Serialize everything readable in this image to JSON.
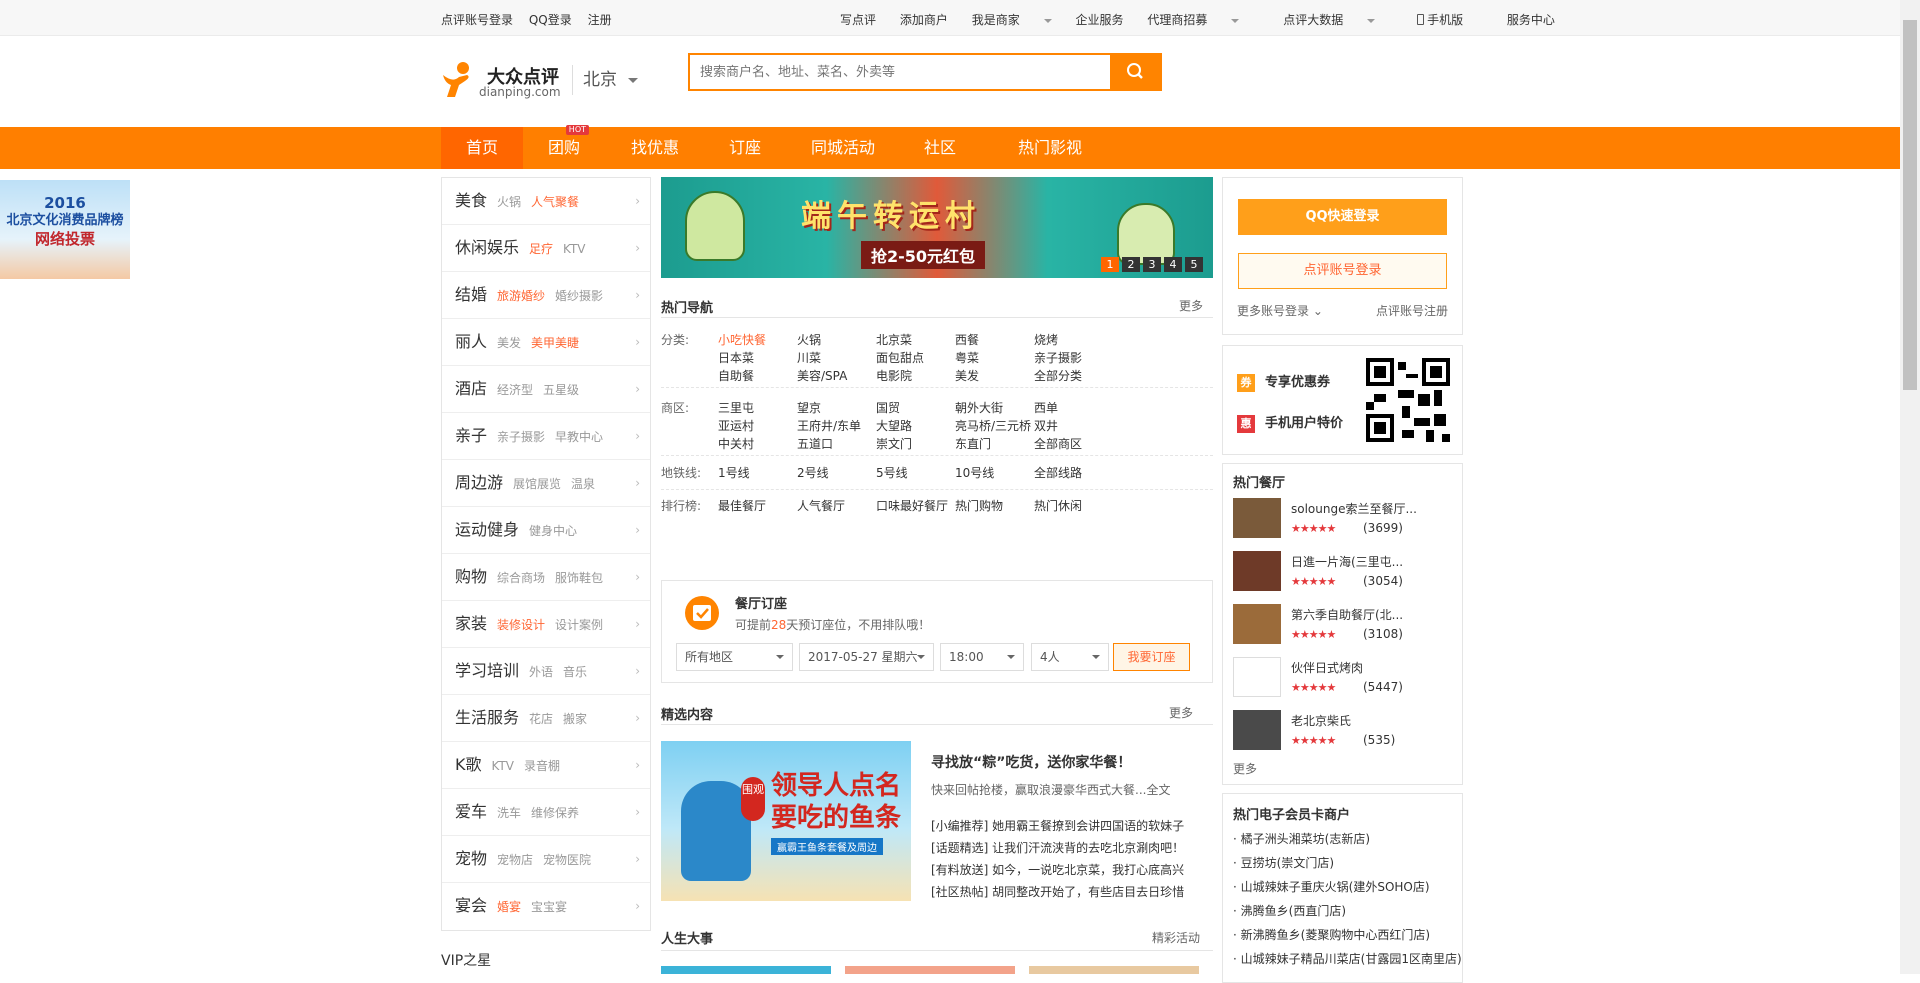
{
  "topbar": {
    "left": [
      "点评账号登录",
      "QQ登录",
      "注册"
    ],
    "right": [
      "写点评",
      "添加商户",
      "我是商家",
      "企业服务",
      "代理商招募",
      "点评大数据",
      "手机版",
      "服务中心"
    ]
  },
  "header": {
    "logo_cn": "大众点评",
    "logo_en": "dianping.com",
    "city": "北京",
    "search_placeholder": "搜索商户名、地址、菜名、外卖等"
  },
  "nav": {
    "items": [
      "首页",
      "团购",
      "找优惠",
      "订座",
      "同城活动",
      "社区",
      "热门影视"
    ],
    "hot_badge": "HOT"
  },
  "left_banner": {
    "line1": "2016",
    "line2": "北京文化消费品牌榜",
    "line3": "网络投票"
  },
  "categories": [
    {
      "name": "美食",
      "subs": [
        "火锅",
        "人气聚餐"
      ],
      "hl": [
        false,
        true
      ]
    },
    {
      "name": "休闲娱乐",
      "subs": [
        "足疗",
        "KTV"
      ],
      "hl": [
        true,
        false
      ]
    },
    {
      "name": "结婚",
      "subs": [
        "旅游婚纱",
        "婚纱摄影"
      ],
      "hl": [
        true,
        false
      ]
    },
    {
      "name": "丽人",
      "subs": [
        "美发",
        "美甲美睫"
      ],
      "hl": [
        false,
        true
      ]
    },
    {
      "name": "酒店",
      "subs": [
        "经济型",
        "五星级"
      ],
      "hl": [
        false,
        false
      ]
    },
    {
      "name": "亲子",
      "subs": [
        "亲子摄影",
        "早教中心"
      ],
      "hl": [
        false,
        false
      ]
    },
    {
      "name": "周边游",
      "subs": [
        "展馆展览",
        "温泉"
      ],
      "hl": [
        false,
        false
      ]
    },
    {
      "name": "运动健身",
      "subs": [
        "健身中心"
      ],
      "hl": [
        false
      ]
    },
    {
      "name": "购物",
      "subs": [
        "综合商场",
        "服饰鞋包"
      ],
      "hl": [
        false,
        false
      ]
    },
    {
      "name": "家装",
      "subs": [
        "装修设计",
        "设计案例"
      ],
      "hl": [
        true,
        false
      ]
    },
    {
      "name": "学习培训",
      "subs": [
        "外语",
        "音乐"
      ],
      "hl": [
        false,
        false
      ]
    },
    {
      "name": "生活服务",
      "subs": [
        "花店",
        "搬家"
      ],
      "hl": [
        false,
        false
      ]
    },
    {
      "name": "K歌",
      "subs": [
        "KTV",
        "录音棚"
      ],
      "hl": [
        false,
        false
      ]
    },
    {
      "name": "爱车",
      "subs": [
        "洗车",
        "维修保养"
      ],
      "hl": [
        false,
        false
      ]
    },
    {
      "name": "宠物",
      "subs": [
        "宠物店",
        "宠物医院"
      ],
      "hl": [
        false,
        false
      ]
    },
    {
      "name": "宴会",
      "subs": [
        "婚宴",
        "宝宝宴"
      ],
      "hl": [
        true,
        false
      ]
    }
  ],
  "vip_title": "VIP之星",
  "promo": {
    "title": "端午转运村",
    "subtitle": "抢2-50元红包",
    "pages": [
      "1",
      "2",
      "3",
      "4",
      "5"
    ]
  },
  "hot_nav": {
    "title": "热门导航",
    "more": "更多",
    "category_label": "分类:",
    "categories": [
      "小吃快餐",
      "火锅",
      "北京菜",
      "西餐",
      "烧烤",
      "日本菜",
      "川菜",
      "面包甜点",
      "粤菜",
      "亲子摄影",
      "自助餐",
      "美容/SPA",
      "电影院",
      "美发",
      "全部分类"
    ],
    "area_label": "商区:",
    "areas": [
      "三里屯",
      "望京",
      "国贸",
      "朝外大街",
      "西单",
      "亚运村",
      "王府井/东单",
      "大望路",
      "亮马桥/三元桥",
      "双井",
      "中关村",
      "五道口",
      "崇文门",
      "东直门",
      "全部商区"
    ],
    "metro_label": "地铁线:",
    "metro": [
      "1号线",
      "2号线",
      "5号线",
      "10号线",
      "全部线路"
    ],
    "rank_label": "排行榜:",
    "ranks": [
      "最佳餐厅",
      "人气餐厅",
      "口味最好餐厅",
      "热门购物",
      "热门休闲"
    ]
  },
  "booking": {
    "title": "餐厅订座",
    "desc_pre": "可提前",
    "days": "28",
    "desc_post": "天预订座位，不用排队哦！",
    "area": "所有地区",
    "date": "2017-05-27 星期六",
    "time": "18:00",
    "people": "4人",
    "button": "我要订座"
  },
  "featured": {
    "title": "精选内容",
    "more": "更多",
    "img_line1": "领导人点名",
    "img_line2": "要吃的鱼条",
    "img_tag": "赢霸王鱼条套餐及周边",
    "img_badge": "围观",
    "headline": "寻找放“粽”吃货，送你家华餐！",
    "sub": "快来回帖抢楼，赢取浪漫豪华西式大餐...全文",
    "items": [
      "[小编推荐] 她用霸王餐撩到会讲四国语的软妹子",
      "[话题精选] 让我们汗流浃背的去吃北京涮肉吧！",
      "[有料放送] 如今，一说吃北京菜，我打心底高兴",
      "[社区热帖] 胡同整改开始了，有些店目去日珍惜"
    ]
  },
  "life": {
    "title": "人生大事",
    "more": "精彩活动"
  },
  "login": {
    "qq": "QQ快速登录",
    "dp": "点评账号登录",
    "more": "更多账号登录",
    "register": "点评账号注册"
  },
  "coupon": {
    "item1_badge": "券",
    "item1": "专享优惠券",
    "item2_badge": "惠",
    "item2": "手机用户特价"
  },
  "hot_restaurants": {
    "title": "热门餐厅",
    "more": "更多",
    "items": [
      {
        "name": "solounge索兰至餐厅...",
        "count": "(3699)"
      },
      {
        "name": "日進一片海(三里屯...",
        "count": "(3054)"
      },
      {
        "name": "第六季自助餐厅(北...",
        "count": "(3108)"
      },
      {
        "name": "伙伴日式烤肉",
        "count": "(5447)"
      },
      {
        "name": "老北京柴氏",
        "count": "(535)"
      }
    ],
    "stars": "★★★★★"
  },
  "ecard": {
    "title": "热门电子会员卡商户",
    "items": [
      "橘子洲头湘菜坊(志新店)",
      "豆捞坊(崇文门店)",
      "山城辣妹子重庆火锅(建外SOHO店)",
      "沸腾鱼乡(西直门店)",
      "新沸腾鱼乡(菱聚购物中心西红门店)",
      "山城辣妹子精品川菜店(甘露园1区南里店)"
    ]
  },
  "colors": {
    "accent": "#ff7f00",
    "highlight": "#ff6633"
  }
}
